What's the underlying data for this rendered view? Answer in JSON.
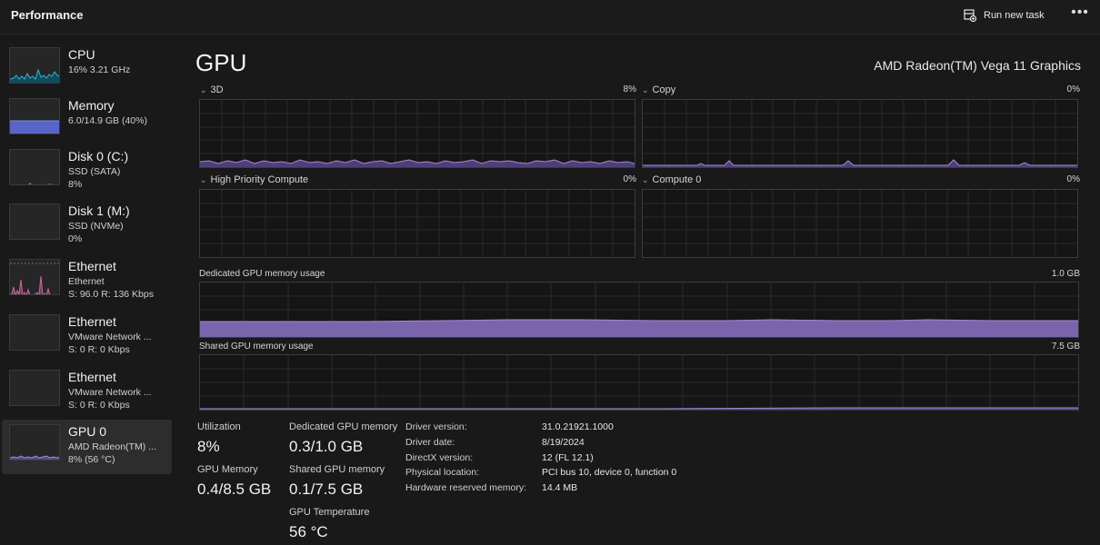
{
  "header": {
    "title": "Performance",
    "run_new_task": "Run new task",
    "more": "•••"
  },
  "sidebar": {
    "items": [
      {
        "name": "CPU",
        "sub1": "16%  3.21 GHz",
        "sub2": ""
      },
      {
        "name": "Memory",
        "sub1": "6.0/14.9 GB (40%)",
        "sub2": ""
      },
      {
        "name": "Disk 0 (C:)",
        "sub1": "SSD (SATA)",
        "sub2": "8%"
      },
      {
        "name": "Disk 1 (M:)",
        "sub1": "SSD (NVMe)",
        "sub2": "0%"
      },
      {
        "name": "Ethernet",
        "sub1": "Ethernet",
        "sub2": "S: 96.0  R: 136 Kbps"
      },
      {
        "name": "Ethernet",
        "sub1": "VMware Network ...",
        "sub2": "S: 0  R: 0 Kbps"
      },
      {
        "name": "Ethernet",
        "sub1": "VMware Network ...",
        "sub2": "S: 0  R: 0 Kbps"
      },
      {
        "name": "GPU 0",
        "sub1": "AMD Radeon(TM) ...",
        "sub2": "8%  (56 °C)"
      }
    ]
  },
  "main": {
    "title": "GPU",
    "adapter": "AMD Radeon(TM) Vega 11 Graphics",
    "engines": [
      {
        "label": "3D",
        "value": "8%"
      },
      {
        "label": "Copy",
        "value": "0%"
      },
      {
        "label": "High Priority Compute",
        "value": "0%"
      },
      {
        "label": "Compute 0",
        "value": "0%"
      }
    ],
    "dedicated": {
      "label": "Dedicated GPU memory usage",
      "max": "1.0 GB"
    },
    "shared": {
      "label": "Shared GPU memory usage",
      "max": "7.5 GB"
    }
  },
  "stats": {
    "utilization": {
      "label": "Utilization",
      "value": "8%"
    },
    "gpu_memory": {
      "label": "GPU Memory",
      "value": "0.4/8.5 GB"
    },
    "dedicated": {
      "label": "Dedicated GPU memory",
      "value": "0.3/1.0 GB"
    },
    "shared": {
      "label": "Shared GPU memory",
      "value": "0.1/7.5 GB"
    },
    "temperature": {
      "label": "GPU Temperature",
      "value": "56 °C"
    }
  },
  "info": [
    {
      "label": "Driver version:",
      "value": "31.0.21921.1000"
    },
    {
      "label": "Driver date:",
      "value": "8/19/2024"
    },
    {
      "label": "DirectX version:",
      "value": "12 (FL 12.1)"
    },
    {
      "label": "Physical location:",
      "value": "PCI bus 10, device 0, function 0"
    },
    {
      "label": "Hardware reserved memory:",
      "value": "14.4 MB"
    }
  ],
  "colors": {
    "gpu": "#a48ad6",
    "gpu_fill": "#6f5aa3",
    "cpu": "#2bb5d8",
    "memory": "#7b86e0",
    "disk": "#5fb85a",
    "ethernet": "#c46aa0"
  },
  "icons": {
    "run_task": "run-task-icon",
    "more": "more-icon",
    "chevron": "chevron-down-icon"
  }
}
